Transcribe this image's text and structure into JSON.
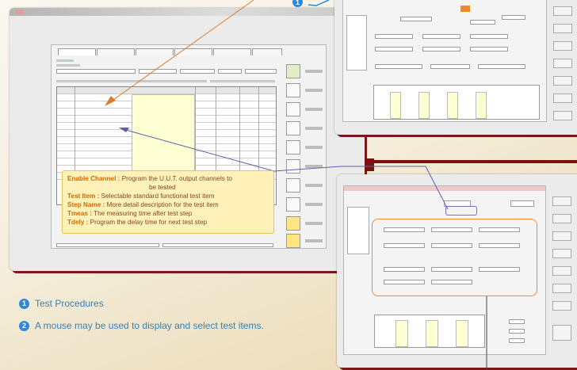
{
  "badges": {
    "one": "1",
    "two": "2"
  },
  "tooltip": {
    "enable_key": "Enable Channel :",
    "enable_desc": "Program the U.U.T. output channels to",
    "enable_desc2": "be tested",
    "test_item_key": "Test Item :",
    "test_item_desc": "Selectable standard functional test item",
    "step_name_key": "Step Name :",
    "step_name_desc": "More detail description for the test item",
    "tmeas_key": "Tmeas :",
    "tmeas_desc": "The measuring time after test step",
    "tdely_key": "Tdely :",
    "tdely_desc": "Program the delay time for next test step"
  },
  "captions": {
    "c1_num": "1",
    "c1_text": "Test Procedures",
    "c2_num": "2",
    "c2_text": "A mouse may be used to display and select test items."
  },
  "colors": {
    "accent_orange": "#e88a3c",
    "badge_blue": "#2e8ad6",
    "caption_blue": "#3a7fb0",
    "tooltip_bg": "#fff1b8",
    "frame_red": "#7a1212"
  }
}
